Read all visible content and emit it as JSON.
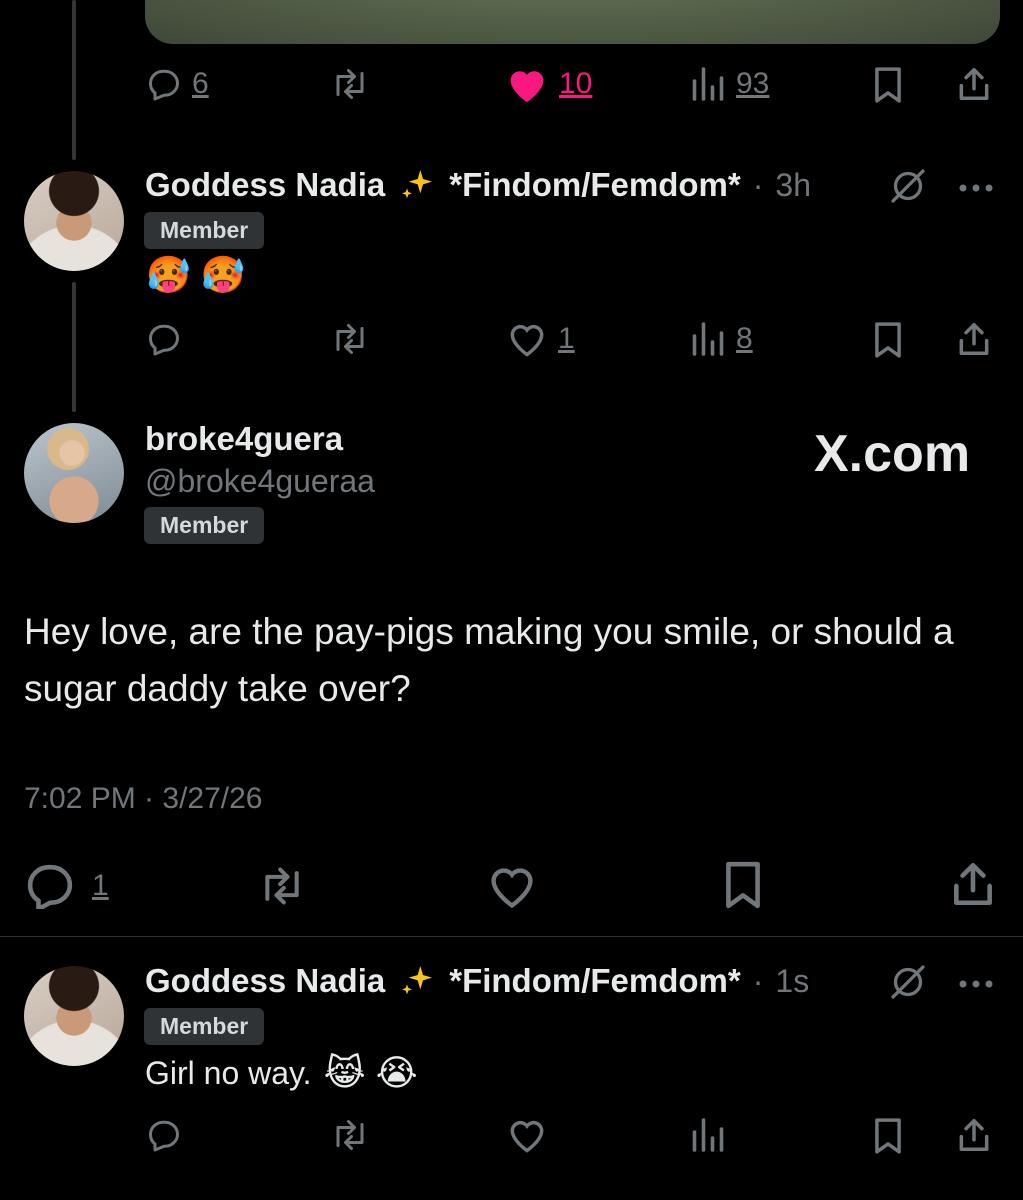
{
  "top_actions": {
    "reply_count": "6",
    "like_count": "10",
    "view_count": "93",
    "like_color": "#f91880"
  },
  "reply1": {
    "author": "Goddess Nadia",
    "author_suffix": "*Findom/Femdom*",
    "separator": "·",
    "time": "3h",
    "badge": "Member",
    "text": "🥵 🥵",
    "actions": {
      "like_count": "1",
      "view_count": "8"
    }
  },
  "main_post": {
    "display_name": "broke4guera",
    "handle": "@broke4gueraa",
    "badge": "Member",
    "brand": "X.com",
    "text": "Hey love, are the pay-pigs making you smile, or should a sugar daddy take over?",
    "timestamp": "7:02 PM · 3/27/26",
    "actions": {
      "reply_count": "1"
    }
  },
  "reply2": {
    "author": "Goddess Nadia",
    "author_suffix": "*Findom/Femdom*",
    "separator": "·",
    "time": "1s",
    "badge": "Member",
    "text": "Girl no way.",
    "emoji": "😹 😭"
  },
  "icons": {
    "reply": "speech-bubble-icon",
    "repost": "repost-arrows-icon",
    "like": "heart-icon",
    "views": "bar-chart-icon",
    "bookmark": "bookmark-icon",
    "share": "share-upload-icon",
    "grok": "slashed-circle-icon",
    "more": "more-dots-icon",
    "sparkles": "sparkles-icon"
  }
}
